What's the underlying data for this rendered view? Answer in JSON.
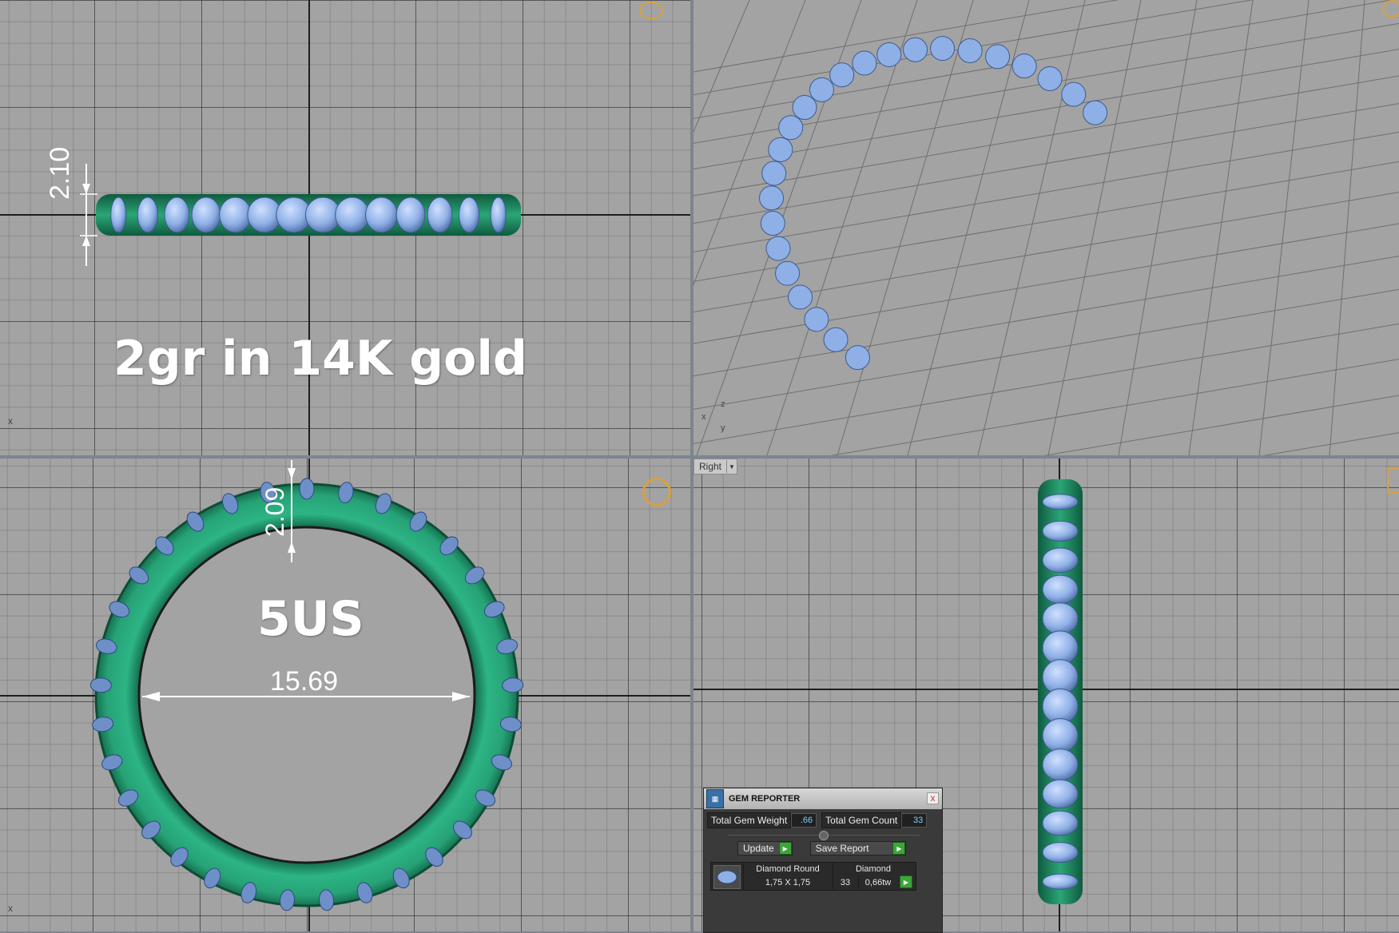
{
  "overlays": {
    "weight_label": "2gr in 14K gold",
    "size_label": "5US",
    "dim_height_top": "2.10",
    "dim_height_bottom": "2.09",
    "dim_inner_diameter": "15.69"
  },
  "viewports": {
    "bottom_right_view_name": "Right"
  },
  "gem_reporter": {
    "title": "GEM REPORTER",
    "close_label": "x",
    "total_gem_weight_label": "Total Gem Weight",
    "total_gem_weight_value": ".66",
    "total_gem_count_label": "Total Gem Count",
    "total_gem_count_value": "33",
    "update_label": "Update",
    "save_report_label": "Save Report",
    "gem_row": {
      "shape": "Diamond Round",
      "size": "1,75 X 1,75",
      "material": "Diamond",
      "count": "33",
      "weight": "0,66tw"
    }
  },
  "colors": {
    "band": "#1f8a62",
    "gem": "#8fb0e6",
    "viewport_bg": "#a3a3a3",
    "frame": "#7d8592"
  }
}
